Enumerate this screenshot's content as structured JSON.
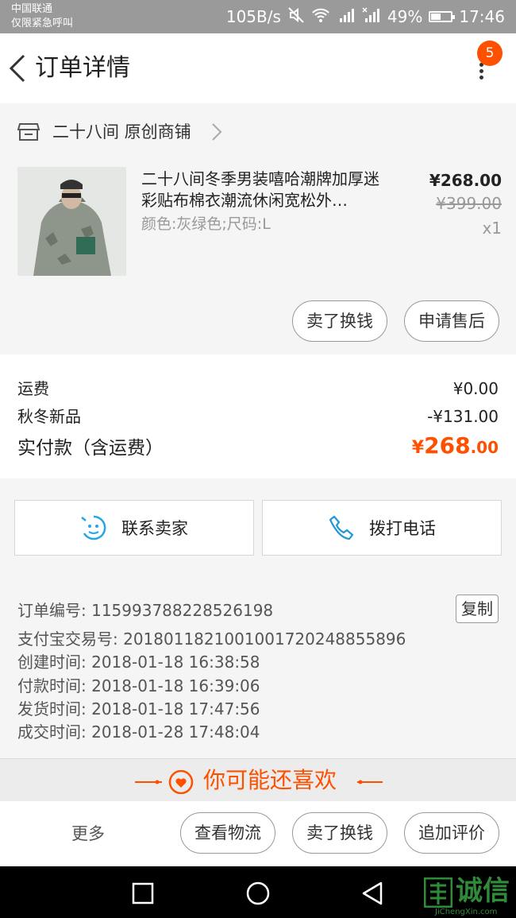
{
  "status_bar": {
    "carrier_line1": "中国联通",
    "carrier_line2": "仅限紧急呼叫",
    "net_speed": "105B/s",
    "battery": "49%",
    "battery_level": 0.49,
    "time": "17:46"
  },
  "header": {
    "title": "订单详情",
    "badge_count": "5"
  },
  "shop": {
    "name": "二十八间 原创商铺"
  },
  "product": {
    "name": "二十八间冬季男装嘻哈潮牌加厚迷彩贴布棉衣潮流休闲宽松外…",
    "attributes": "颜色:灰绿色;尺码:L",
    "price": "¥268.00",
    "original_price": "¥399.00",
    "quantity": "x1",
    "buttons": {
      "sell": "卖了换钱",
      "after_sale": "申请售后"
    }
  },
  "fees": {
    "shipping_label": "运费",
    "shipping_value": "¥0.00",
    "discount_label": "秋冬新品",
    "discount_value": "-¥131.00",
    "total_label": "实付款（含运费）",
    "total_currency": "¥",
    "total_integer": "268",
    "total_decimal": ".00"
  },
  "contact": {
    "seller": "联系卖家",
    "phone": "拨打电话"
  },
  "order_info": {
    "order_no": "订单编号: 115993788228526198",
    "copy_label": "复制",
    "alipay_no": "支付宝交易号: 2018011821001001720248855896",
    "created": "创建时间: 2018-01-18 16:38:58",
    "paid": "付款时间: 2018-01-18 16:39:06",
    "shipped": "发货时间: 2018-01-18 17:47:56",
    "completed": "成交时间: 2018-01-28 17:48:04"
  },
  "recommend": {
    "title": "你可能还喜欢"
  },
  "bottom_actions": {
    "more": "更多",
    "logistics": "查看物流",
    "sell": "卖了换钱",
    "review": "追加评价"
  },
  "watermark": {
    "text": "诚信",
    "sub": "JiChengXin.com"
  },
  "colors": {
    "accent": "#ff5000",
    "status_bar": "#9a9a9a",
    "chat_icon": "#23a7e8",
    "phone_icon": "#2196d6"
  }
}
